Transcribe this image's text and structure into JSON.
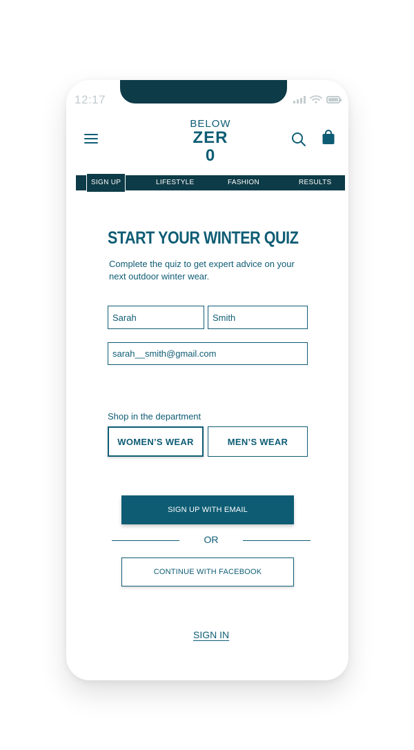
{
  "status_bar": {
    "time": "12:17",
    "icons": [
      "signal-icon",
      "wifi-icon",
      "battery-icon"
    ]
  },
  "header": {
    "menu_icon": "hamburger-menu-icon",
    "logo_top": "BELOW",
    "logo_bottom": "ZER 0",
    "search_icon": "search-icon",
    "bag_icon": "shopping-bag-icon"
  },
  "nav": {
    "tabs": [
      {
        "label": "SIGN UP",
        "active": true
      },
      {
        "label": "LIFESTYLE",
        "active": false
      },
      {
        "label": "FASHION",
        "active": false
      },
      {
        "label": "RESULTS",
        "active": false
      }
    ]
  },
  "main": {
    "title": "START YOUR WINTER QUIZ",
    "subtitle": "Complete the quiz to get expert advice on your next outdoor winter wear.",
    "first_name_value": "Sarah",
    "last_name_value": "Smith",
    "email_value": "sarah__smith@gmail.com",
    "department_label": "Shop in the department",
    "department_options": [
      {
        "label": "WOMEN’S WEAR",
        "selected": true
      },
      {
        "label": "MEN’S WEAR",
        "selected": false
      }
    ],
    "signup_email_label": "SIGN UP WITH EMAIL",
    "or_label": "OR",
    "facebook_label": "CONTINUE WITH FACEBOOK",
    "signin_label": "SIGN IN"
  },
  "colors": {
    "brand": "#0e5c74",
    "nav_bg": "#0d3b47",
    "status_gray": "#c3ccce"
  }
}
